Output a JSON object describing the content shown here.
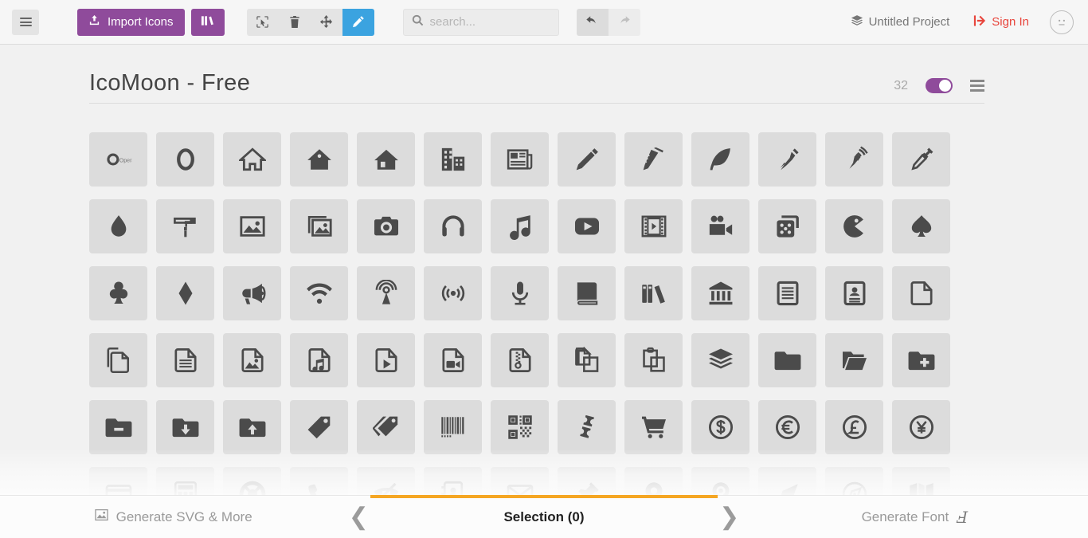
{
  "header": {
    "menu_icon": "hamburger-menu-icon",
    "import_label": "Import Icons",
    "import_icon": "upload-icon",
    "library_icon": "library-books-icon",
    "tools": [
      {
        "name": "select-tool",
        "icon": "cursor-select-icon",
        "active": false
      },
      {
        "name": "delete-tool",
        "icon": "trash-icon",
        "active": false
      },
      {
        "name": "move-tool",
        "icon": "move-arrows-icon",
        "active": false
      },
      {
        "name": "edit-tool",
        "icon": "pencil-icon",
        "active": true
      }
    ],
    "search": {
      "value": "",
      "placeholder": "search...",
      "icon": "search-icon"
    },
    "undo": {
      "icon": "undo-arrow-icon",
      "enabled": true
    },
    "redo": {
      "icon": "redo-arrow-icon",
      "enabled": false
    },
    "project_label": "Untitled Project",
    "project_icon": "stack-layers-icon",
    "signin_label": "Sign In",
    "signin_icon": "login-enter-icon",
    "avatar_icon": "neutral-face-icon"
  },
  "set": {
    "title": "IcoMoon - Free",
    "count": "32",
    "toggle_on": true,
    "menu_icon": "set-menu-icon"
  },
  "footer": {
    "left_tab": {
      "label": "Generate SVG & More",
      "icon": "image-icon"
    },
    "center_tab": {
      "label": "Selection (0)"
    },
    "right_tab": {
      "label": "Generate Font",
      "icon": "font-f-icon"
    },
    "prev_chevron": "chevron-left-icon",
    "next_chevron": "chevron-right-icon"
  },
  "colors": {
    "brand_purple": "#8f4b9b",
    "active_blue": "#3ba3e0",
    "signin_red": "#e8453c",
    "accent_orange": "#f5a623",
    "cell_bg": "#dcdcdc",
    "page_bg": "#f1f1f1"
  },
  "icons": [
    "opera-logo",
    "opera-o",
    "home",
    "home2",
    "home3",
    "office",
    "newspaper",
    "pencil",
    "pencil2",
    "quill",
    "pen",
    "pen-alt",
    "eyedropper",
    "droplet",
    "paint-format",
    "image",
    "images",
    "camera",
    "headphones",
    "music",
    "play",
    "film",
    "video-camera",
    "dice",
    "pacman",
    "spades",
    "clubs",
    "diamonds",
    "bullhorn",
    "connection",
    "podcast",
    "radio",
    "mic",
    "book",
    "books",
    "library",
    "file-text",
    "profile",
    "file-empty",
    "files-empty",
    "file-text2",
    "file-picture",
    "file-music",
    "file-play",
    "file-video",
    "file-zip",
    "copy",
    "paste",
    "stack",
    "folder",
    "folder-open",
    "folder-plus",
    "folder-minus",
    "folder-download",
    "folder-upload",
    "price-tag",
    "price-tags",
    "barcode",
    "qrcode",
    "ticket",
    "cart",
    "coin-dollar",
    "coin-euro",
    "coin-pound",
    "coin-yen",
    "credit-card",
    "calculator",
    "lifebuoy",
    "phone",
    "phone-hang-up",
    "address-book",
    "envelop",
    "pushpin",
    "location",
    "location2",
    "compass",
    "compass2",
    "map"
  ]
}
